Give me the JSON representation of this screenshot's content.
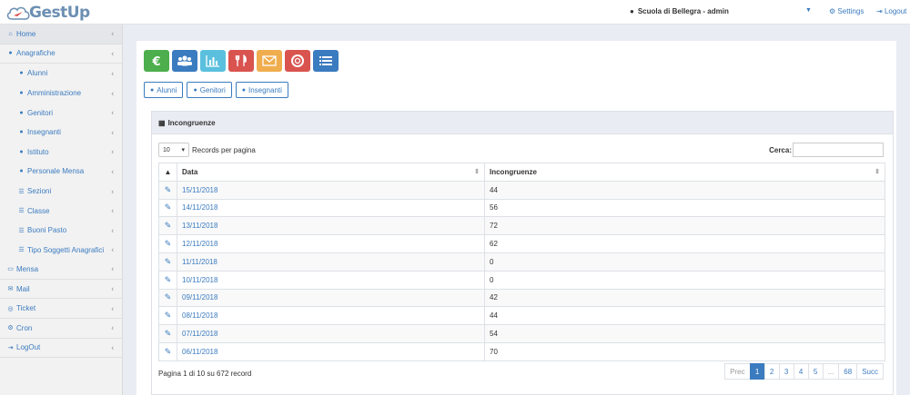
{
  "app": {
    "logo_text": "GestUp",
    "user": "Scuola di Bellegra - admin",
    "settings_label": "Settings",
    "logout_label": "Logout"
  },
  "sidebar": {
    "items": [
      {
        "label": "Home",
        "icon": "home-icon",
        "level": 0
      },
      {
        "label": "Anagrafiche",
        "icon": "user-icon",
        "level": 0
      },
      {
        "label": "Alunni",
        "icon": "user-icon",
        "level": 1
      },
      {
        "label": "Amministrazione",
        "icon": "user-icon",
        "level": 1
      },
      {
        "label": "Genitori",
        "icon": "user-icon",
        "level": 1
      },
      {
        "label": "Insegnanti",
        "icon": "user-icon",
        "level": 1
      },
      {
        "label": "Istituto",
        "icon": "user-icon",
        "level": 1
      },
      {
        "label": "Personale Mensa",
        "icon": "user-icon",
        "level": 1
      },
      {
        "label": "Sezioni",
        "icon": "list-icon",
        "level": 1
      },
      {
        "label": "Classe",
        "icon": "list-icon",
        "level": 1
      },
      {
        "label": "Buoni Pasto",
        "icon": "list-icon",
        "level": 1
      },
      {
        "label": "Tipo Soggetti Anagrafici",
        "icon": "list-icon",
        "level": 1
      },
      {
        "label": "Mensa",
        "icon": "inbox-icon",
        "level": 0
      },
      {
        "label": "Mail",
        "icon": "envelope-icon",
        "level": 0
      },
      {
        "label": "Ticket",
        "icon": "lifebuoy-icon",
        "level": 0
      },
      {
        "label": "Cron",
        "icon": "cogs-icon",
        "level": 0
      },
      {
        "label": "LogOut",
        "icon": "logout-icon",
        "level": 0
      }
    ]
  },
  "toolbar": {
    "tiles": [
      {
        "icon": "euro-icon",
        "color": "#4cae4c"
      },
      {
        "icon": "users-icon",
        "color": "#3b7bbf"
      },
      {
        "icon": "bar-chart-icon",
        "color": "#5bc0de"
      },
      {
        "icon": "cutlery-icon",
        "color": "#d9534f"
      },
      {
        "icon": "envelope-icon",
        "color": "#f0ad4e"
      },
      {
        "icon": "lifebuoy-icon",
        "color": "#d9534f"
      },
      {
        "icon": "list-icon",
        "color": "#3b7bbf"
      }
    ],
    "buttons": [
      "Alunni",
      "Genitori",
      "Insegnanti"
    ]
  },
  "panel": {
    "title": "Incongruenze",
    "page_length": "10",
    "page_length_label": "Records per pagina",
    "search_label": "Cerca:",
    "columns": [
      "Data",
      "Incongruenze"
    ],
    "rows": [
      {
        "date": "15/11/2018",
        "count": "44"
      },
      {
        "date": "14/11/2018",
        "count": "56"
      },
      {
        "date": "13/11/2018",
        "count": "72"
      },
      {
        "date": "12/11/2018",
        "count": "62"
      },
      {
        "date": "11/11/2018",
        "count": "0"
      },
      {
        "date": "10/11/2018",
        "count": "0"
      },
      {
        "date": "09/11/2018",
        "count": "42"
      },
      {
        "date": "08/11/2018",
        "count": "44"
      },
      {
        "date": "07/11/2018",
        "count": "54"
      },
      {
        "date": "06/11/2018",
        "count": "70"
      }
    ],
    "info": "Pagina 1 di 10 su 672 record",
    "pager": [
      "Prec",
      "1",
      "2",
      "3",
      "4",
      "5",
      "...",
      "68",
      "Succ"
    ],
    "active_page": "1"
  }
}
